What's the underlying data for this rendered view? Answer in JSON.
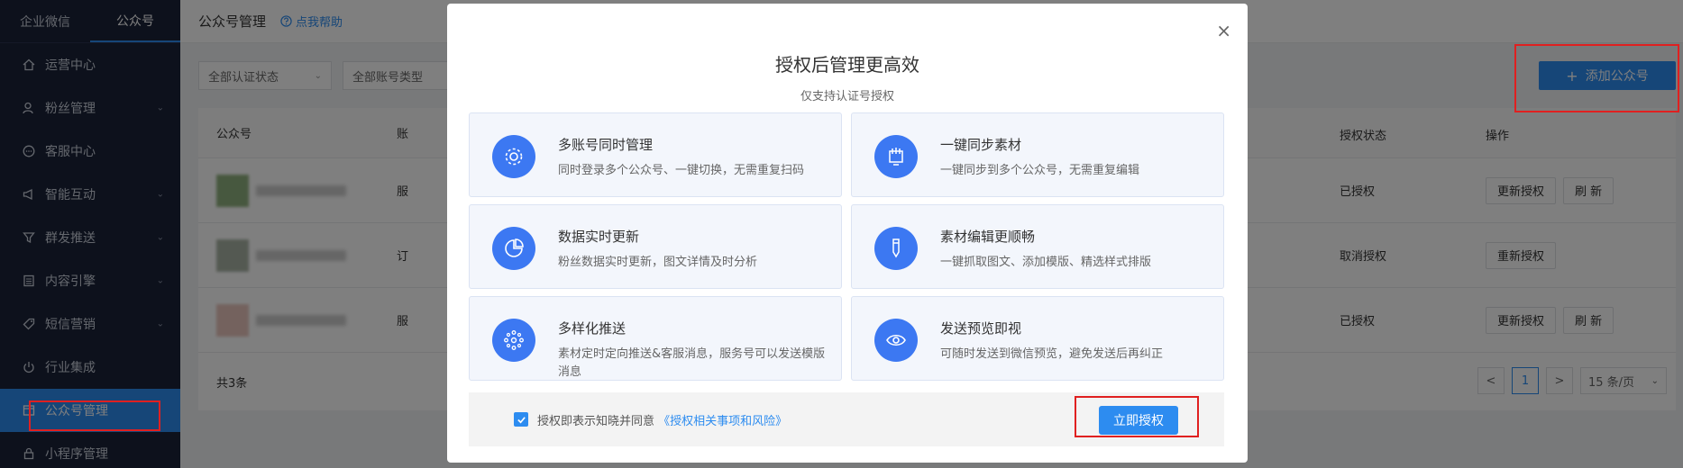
{
  "sidebar": {
    "tabs": [
      "企业微信",
      "公众号"
    ],
    "items": [
      {
        "label": "运营中心",
        "icon": "home-icon",
        "chevron": false
      },
      {
        "label": "粉丝管理",
        "icon": "fans-icon",
        "chevron": true
      },
      {
        "label": "客服中心",
        "icon": "chat-icon",
        "chevron": false
      },
      {
        "label": "智能互动",
        "icon": "megaphone-icon",
        "chevron": true
      },
      {
        "label": "群发推送",
        "icon": "filter-icon",
        "chevron": true
      },
      {
        "label": "内容引擎",
        "icon": "list-icon",
        "chevron": true
      },
      {
        "label": "短信营销",
        "icon": "tag-icon",
        "chevron": true
      },
      {
        "label": "行业集成",
        "icon": "power-icon",
        "chevron": false
      },
      {
        "label": "公众号管理",
        "icon": "account-icon",
        "chevron": false,
        "active": true
      },
      {
        "label": "小程序管理",
        "icon": "lock-icon",
        "chevron": false
      }
    ]
  },
  "topbar": {
    "title": "公众号管理",
    "help": "点我帮助"
  },
  "filters": {
    "auth_status": "全部认证状态",
    "account_type": "全部账号类型"
  },
  "add_button": "添加公众号",
  "table": {
    "headers": {
      "name": "公众号",
      "type": "账",
      "status": "授权状态",
      "ops": "操作"
    },
    "rows": [
      {
        "type": "服",
        "status": "已授权",
        "ops": [
          "更新授权",
          "刷 新"
        ]
      },
      {
        "type": "订",
        "status": "取消授权",
        "ops": [
          "重新授权"
        ]
      },
      {
        "type": "服",
        "status": "已授权",
        "ops": [
          "更新授权",
          "刷 新"
        ]
      }
    ],
    "total": "共3条",
    "pager": {
      "prev": "<",
      "current": "1",
      "next": ">",
      "page_size": "15 条/页"
    }
  },
  "modal": {
    "close": "×",
    "title": "授权后管理更高效",
    "subtitle": "仅支持认证号授权",
    "cards": [
      {
        "title": "多账号同时管理",
        "desc": "同时登录多个公众号、一键切换，无需重复扫码",
        "icon": "gear-icon"
      },
      {
        "title": "一键同步素材",
        "desc": "一键同步到多个公众号，无需重复编辑",
        "icon": "sync-icon"
      },
      {
        "title": "数据实时更新",
        "desc": "粉丝数据实时更新，图文详情及时分析",
        "icon": "pie-chart-icon"
      },
      {
        "title": "素材编辑更顺畅",
        "desc": "一键抓取图文、添加模版、精选样式排版",
        "icon": "pen-icon"
      },
      {
        "title": "多样化推送",
        "desc": "素材定时定向推送&客服消息，服务号可以发送模版消息",
        "icon": "dots-ring-icon"
      },
      {
        "title": "发送预览即视",
        "desc": "可随时发送到微信预览，避免发送后再纠正",
        "icon": "eye-icon"
      }
    ],
    "agree_text": "授权即表示知晓并同意",
    "agree_link": "《授权相关事项和风险》",
    "authorize_button": "立即授权"
  },
  "colors": {
    "primary": "#2d8cf0",
    "sidebar_bg": "#1b2338",
    "icon_bg": "#3c78f2",
    "highlight_red": "#e02020"
  }
}
